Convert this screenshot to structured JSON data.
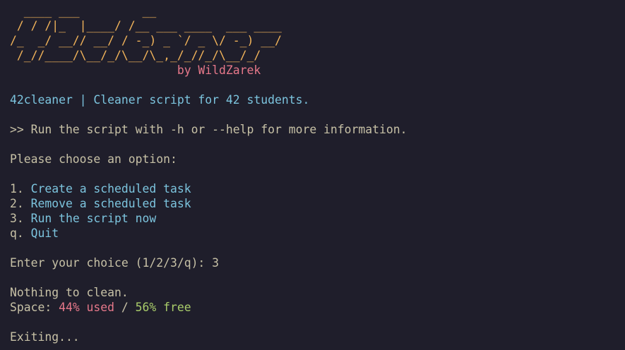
{
  "colors": {
    "background": "#1f1e2b",
    "default_text": "#c7c1a6",
    "banner": "#f2b45a",
    "author": "#e6788a",
    "accent_cyan": "#7cc4de",
    "used": "#e6788a",
    "free": "#a9cc6a"
  },
  "banner": {
    "lines": [
      "  ____ ___         __",
      " / / /|_  |____/ /__ ___ ____  ___ ____",
      "/_  _/ __// __/ / -_) _ `/ _ \\/ -_) __/",
      " /_//____/\\__/_/\\__/\\_,_/_//_/\\__/_/"
    ],
    "author": "                        by WildZarek"
  },
  "header": {
    "title": "42cleaner | Cleaner script for 42 students.",
    "help_hint": ">> Run the script with -h or --help for more information."
  },
  "menu": {
    "prompt": "Please choose an option:",
    "options": [
      {
        "key": "1.",
        "label": "Create a scheduled task"
      },
      {
        "key": "2.",
        "label": "Remove a scheduled task"
      },
      {
        "key": "3.",
        "label": "Run the script now"
      },
      {
        "key": "q.",
        "label": "Quit"
      }
    ]
  },
  "input": {
    "prompt": "Enter your choice (1/2/3/q): ",
    "value": "3"
  },
  "result": {
    "message": "Nothing to clean.",
    "space_label": "Space: ",
    "used": "44% used",
    "separator": " / ",
    "free": "56% free",
    "exit_message": "Exiting..."
  }
}
